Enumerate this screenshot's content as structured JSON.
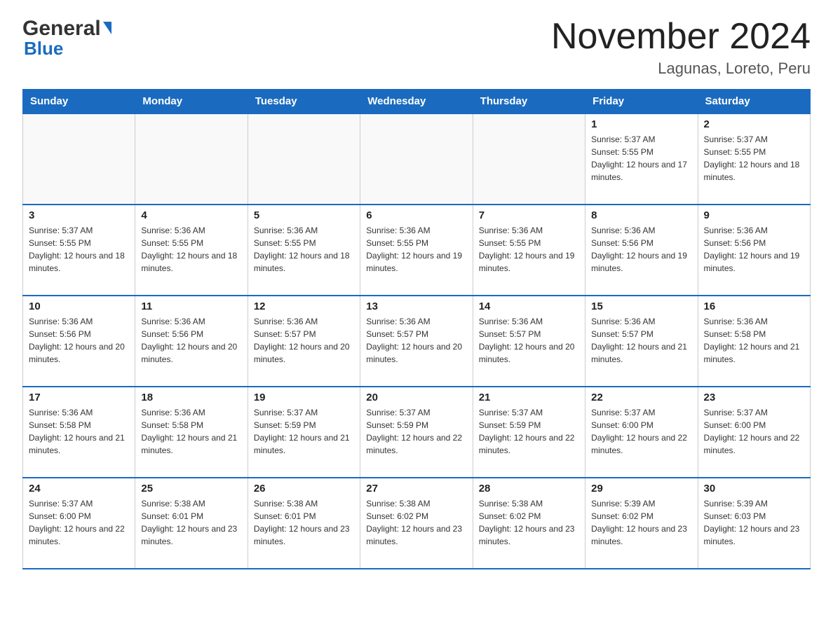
{
  "header": {
    "logo_general": "General",
    "logo_blue": "Blue",
    "month_title": "November 2024",
    "location": "Lagunas, Loreto, Peru"
  },
  "weekdays": [
    "Sunday",
    "Monday",
    "Tuesday",
    "Wednesday",
    "Thursday",
    "Friday",
    "Saturday"
  ],
  "weeks": [
    [
      {
        "day": "",
        "sunrise": "",
        "sunset": "",
        "daylight": ""
      },
      {
        "day": "",
        "sunrise": "",
        "sunset": "",
        "daylight": ""
      },
      {
        "day": "",
        "sunrise": "",
        "sunset": "",
        "daylight": ""
      },
      {
        "day": "",
        "sunrise": "",
        "sunset": "",
        "daylight": ""
      },
      {
        "day": "",
        "sunrise": "",
        "sunset": "",
        "daylight": ""
      },
      {
        "day": "1",
        "sunrise": "Sunrise: 5:37 AM",
        "sunset": "Sunset: 5:55 PM",
        "daylight": "Daylight: 12 hours and 17 minutes."
      },
      {
        "day": "2",
        "sunrise": "Sunrise: 5:37 AM",
        "sunset": "Sunset: 5:55 PM",
        "daylight": "Daylight: 12 hours and 18 minutes."
      }
    ],
    [
      {
        "day": "3",
        "sunrise": "Sunrise: 5:37 AM",
        "sunset": "Sunset: 5:55 PM",
        "daylight": "Daylight: 12 hours and 18 minutes."
      },
      {
        "day": "4",
        "sunrise": "Sunrise: 5:36 AM",
        "sunset": "Sunset: 5:55 PM",
        "daylight": "Daylight: 12 hours and 18 minutes."
      },
      {
        "day": "5",
        "sunrise": "Sunrise: 5:36 AM",
        "sunset": "Sunset: 5:55 PM",
        "daylight": "Daylight: 12 hours and 18 minutes."
      },
      {
        "day": "6",
        "sunrise": "Sunrise: 5:36 AM",
        "sunset": "Sunset: 5:55 PM",
        "daylight": "Daylight: 12 hours and 19 minutes."
      },
      {
        "day": "7",
        "sunrise": "Sunrise: 5:36 AM",
        "sunset": "Sunset: 5:55 PM",
        "daylight": "Daylight: 12 hours and 19 minutes."
      },
      {
        "day": "8",
        "sunrise": "Sunrise: 5:36 AM",
        "sunset": "Sunset: 5:56 PM",
        "daylight": "Daylight: 12 hours and 19 minutes."
      },
      {
        "day": "9",
        "sunrise": "Sunrise: 5:36 AM",
        "sunset": "Sunset: 5:56 PM",
        "daylight": "Daylight: 12 hours and 19 minutes."
      }
    ],
    [
      {
        "day": "10",
        "sunrise": "Sunrise: 5:36 AM",
        "sunset": "Sunset: 5:56 PM",
        "daylight": "Daylight: 12 hours and 20 minutes."
      },
      {
        "day": "11",
        "sunrise": "Sunrise: 5:36 AM",
        "sunset": "Sunset: 5:56 PM",
        "daylight": "Daylight: 12 hours and 20 minutes."
      },
      {
        "day": "12",
        "sunrise": "Sunrise: 5:36 AM",
        "sunset": "Sunset: 5:57 PM",
        "daylight": "Daylight: 12 hours and 20 minutes."
      },
      {
        "day": "13",
        "sunrise": "Sunrise: 5:36 AM",
        "sunset": "Sunset: 5:57 PM",
        "daylight": "Daylight: 12 hours and 20 minutes."
      },
      {
        "day": "14",
        "sunrise": "Sunrise: 5:36 AM",
        "sunset": "Sunset: 5:57 PM",
        "daylight": "Daylight: 12 hours and 20 minutes."
      },
      {
        "day": "15",
        "sunrise": "Sunrise: 5:36 AM",
        "sunset": "Sunset: 5:57 PM",
        "daylight": "Daylight: 12 hours and 21 minutes."
      },
      {
        "day": "16",
        "sunrise": "Sunrise: 5:36 AM",
        "sunset": "Sunset: 5:58 PM",
        "daylight": "Daylight: 12 hours and 21 minutes."
      }
    ],
    [
      {
        "day": "17",
        "sunrise": "Sunrise: 5:36 AM",
        "sunset": "Sunset: 5:58 PM",
        "daylight": "Daylight: 12 hours and 21 minutes."
      },
      {
        "day": "18",
        "sunrise": "Sunrise: 5:36 AM",
        "sunset": "Sunset: 5:58 PM",
        "daylight": "Daylight: 12 hours and 21 minutes."
      },
      {
        "day": "19",
        "sunrise": "Sunrise: 5:37 AM",
        "sunset": "Sunset: 5:59 PM",
        "daylight": "Daylight: 12 hours and 21 minutes."
      },
      {
        "day": "20",
        "sunrise": "Sunrise: 5:37 AM",
        "sunset": "Sunset: 5:59 PM",
        "daylight": "Daylight: 12 hours and 22 minutes."
      },
      {
        "day": "21",
        "sunrise": "Sunrise: 5:37 AM",
        "sunset": "Sunset: 5:59 PM",
        "daylight": "Daylight: 12 hours and 22 minutes."
      },
      {
        "day": "22",
        "sunrise": "Sunrise: 5:37 AM",
        "sunset": "Sunset: 6:00 PM",
        "daylight": "Daylight: 12 hours and 22 minutes."
      },
      {
        "day": "23",
        "sunrise": "Sunrise: 5:37 AM",
        "sunset": "Sunset: 6:00 PM",
        "daylight": "Daylight: 12 hours and 22 minutes."
      }
    ],
    [
      {
        "day": "24",
        "sunrise": "Sunrise: 5:37 AM",
        "sunset": "Sunset: 6:00 PM",
        "daylight": "Daylight: 12 hours and 22 minutes."
      },
      {
        "day": "25",
        "sunrise": "Sunrise: 5:38 AM",
        "sunset": "Sunset: 6:01 PM",
        "daylight": "Daylight: 12 hours and 23 minutes."
      },
      {
        "day": "26",
        "sunrise": "Sunrise: 5:38 AM",
        "sunset": "Sunset: 6:01 PM",
        "daylight": "Daylight: 12 hours and 23 minutes."
      },
      {
        "day": "27",
        "sunrise": "Sunrise: 5:38 AM",
        "sunset": "Sunset: 6:02 PM",
        "daylight": "Daylight: 12 hours and 23 minutes."
      },
      {
        "day": "28",
        "sunrise": "Sunrise: 5:38 AM",
        "sunset": "Sunset: 6:02 PM",
        "daylight": "Daylight: 12 hours and 23 minutes."
      },
      {
        "day": "29",
        "sunrise": "Sunrise: 5:39 AM",
        "sunset": "Sunset: 6:02 PM",
        "daylight": "Daylight: 12 hours and 23 minutes."
      },
      {
        "day": "30",
        "sunrise": "Sunrise: 5:39 AM",
        "sunset": "Sunset: 6:03 PM",
        "daylight": "Daylight: 12 hours and 23 minutes."
      }
    ]
  ]
}
